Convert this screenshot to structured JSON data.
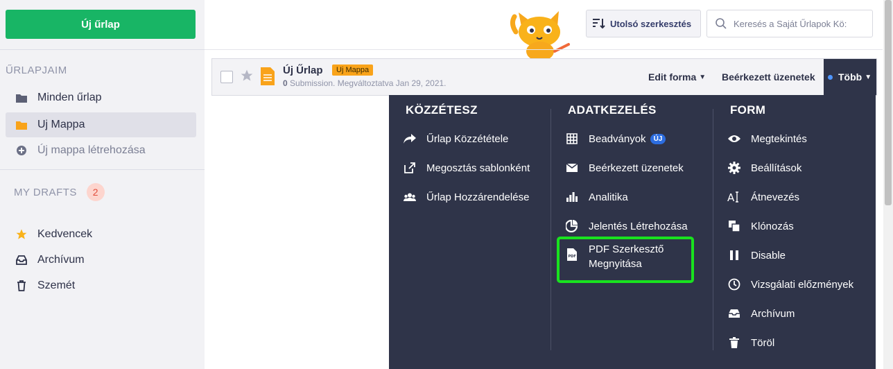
{
  "sidebar": {
    "new_form_label": "Új űrlap",
    "section_heading": "ŰRLAPJAIM",
    "items": [
      {
        "label": "Minden űrlap",
        "icon": "folder-icon"
      },
      {
        "label": "Uj Mappa",
        "icon": "folder-icon",
        "color": "#f9a31a"
      },
      {
        "label": "Új mappa létrehozása",
        "icon": "plus-circle-icon"
      }
    ],
    "drafts_label": "MY DRAFTS",
    "drafts_count": "2",
    "bottom_items": [
      {
        "label": "Kedvencek",
        "icon": "star-icon"
      },
      {
        "label": "Archívum",
        "icon": "inbox-icon"
      },
      {
        "label": "Szemét",
        "icon": "trash-icon"
      }
    ]
  },
  "toolbar": {
    "sort_label": "Utolsó szerkesztés",
    "search_placeholder": "Keresés a Saját Űrlapok Kö:"
  },
  "form": {
    "title": "Új Űrlap",
    "folder_tag": "Uj Mappa",
    "submissions": "0",
    "subtitle": "Submission. Megváltoztatva Jan 29, 2021.",
    "edit_label": "Edit forma",
    "inbox_label": "Beérkezett üzenetek",
    "more_label": "Több"
  },
  "menu": {
    "col1": {
      "title": "KÖZZÉTESZ",
      "items": [
        "Űrlap Közzététele",
        "Megosztás sablonként",
        "Űrlap Hozzárendelése"
      ]
    },
    "col2": {
      "title": "ADATKEZELÉS",
      "items": [
        "Beadványok",
        "Beérkezett üzenetek",
        "Analitika",
        "Jelentés Létrehozása"
      ],
      "new_badge": "ÚJ",
      "pdf_line1": "PDF Szerkesztő",
      "pdf_line2": "Megnyitása"
    },
    "col3": {
      "title": "FORM",
      "items": [
        "Megtekintés",
        "Beállítások",
        "Átnevezés",
        "Klónozás",
        "Disable",
        "Vizsgálati előzmények",
        "Archívum",
        "Töröl"
      ]
    }
  },
  "colors": {
    "primary_green": "#18b565",
    "menu_bg": "#2f3449",
    "folder_orange": "#f9a31a",
    "highlight_green": "#19e21f"
  }
}
